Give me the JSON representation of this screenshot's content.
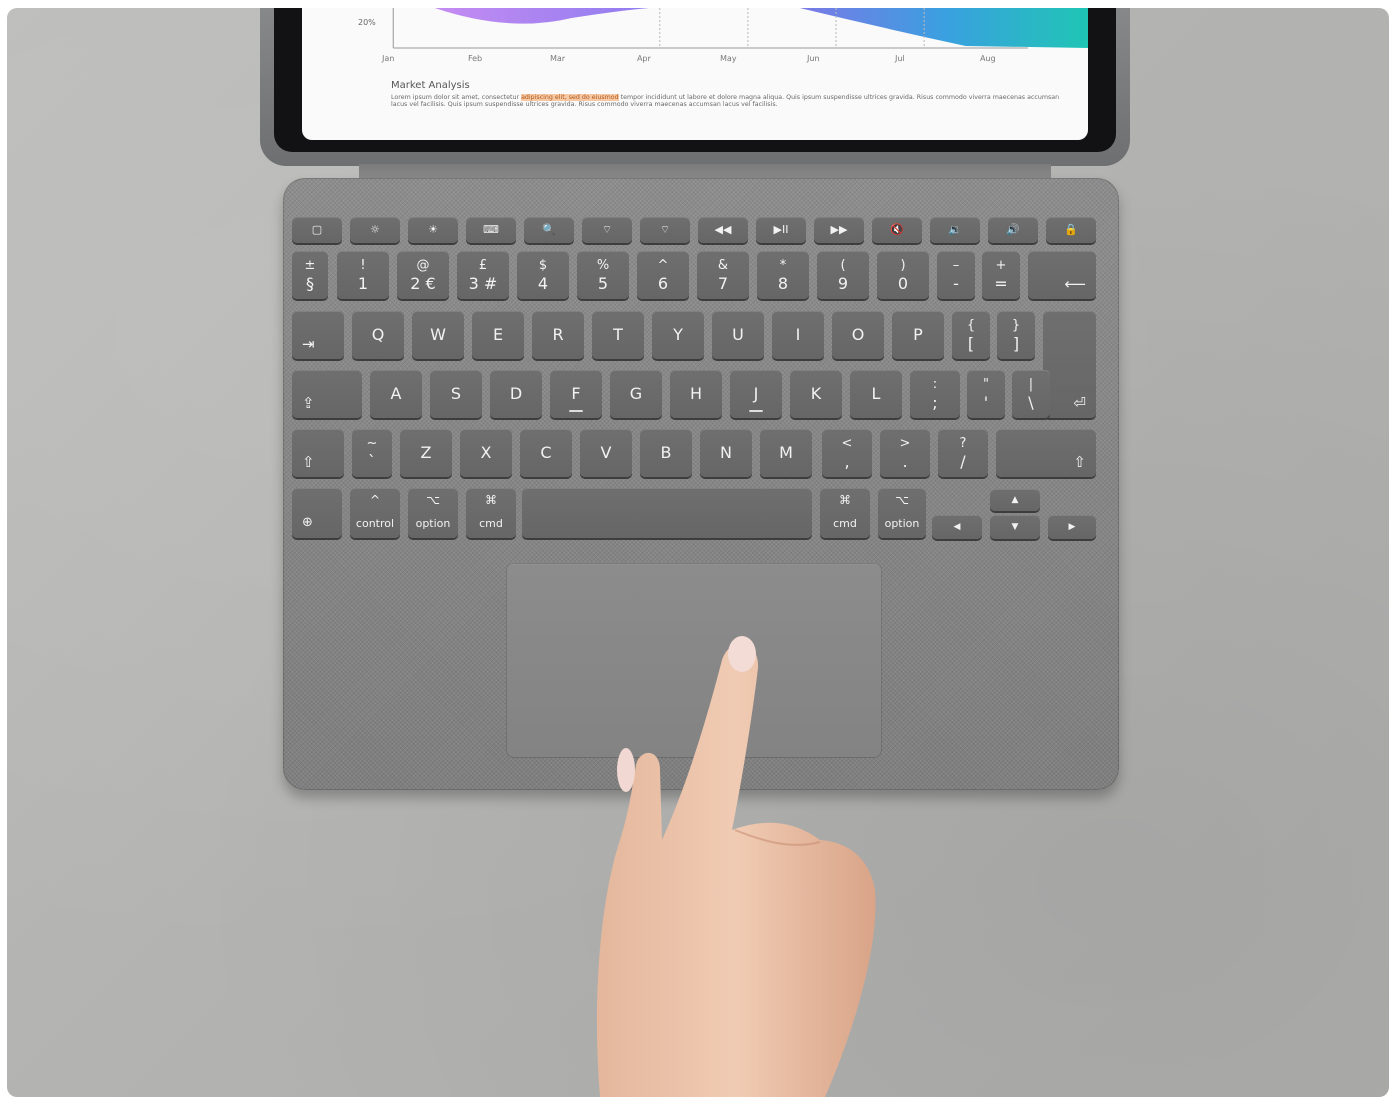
{
  "chart": {
    "percent_label": "20%",
    "months": [
      "Jan",
      "Feb",
      "Mar",
      "Apr",
      "May",
      "Jun",
      "Jul",
      "Aug"
    ]
  },
  "document": {
    "title": "Market Analysis",
    "body_before": "Lorem ipsum dolor sit amet, consectetur ",
    "body_highlight": "adipiscing elit, sed do eiusmod",
    "body_after": " tempor incididunt ut labore et dolore magna aliqua. Quis ipsum suspendisse ultrices gravida. Risus commodo viverra maecenas accumsan lacus vel facilisis. Quis ipsum suspendisse ultrices gravida. Risus commodo viverra maecenas accumsan lacus vel facilisis."
  },
  "keyboard": {
    "function_row": [
      "▢",
      "☼",
      "☀",
      "⌨",
      "🔍",
      "⌔",
      "⌔",
      "◀◀",
      "▶II",
      "▶▶",
      "🔇",
      "🔉",
      "🔊",
      "🔒"
    ],
    "number_row": [
      {
        "top": "±",
        "bot": "§"
      },
      {
        "top": "!",
        "bot": "1"
      },
      {
        "top": "@",
        "bot": "2 €"
      },
      {
        "top": "£",
        "bot": "3 #"
      },
      {
        "top": "$",
        "bot": "4"
      },
      {
        "top": "%",
        "bot": "5"
      },
      {
        "top": "^",
        "bot": "6"
      },
      {
        "top": "&",
        "bot": "7"
      },
      {
        "top": "*",
        "bot": "8"
      },
      {
        "top": "(",
        "bot": "9"
      },
      {
        "top": ")",
        "bot": "0"
      },
      {
        "top": "–",
        "bot": "-"
      },
      {
        "top": "+",
        "bot": "="
      }
    ],
    "backspace": "⟵",
    "tab": "⇥",
    "qwerty_row": [
      "Q",
      "W",
      "E",
      "R",
      "T",
      "Y",
      "U",
      "I",
      "O",
      "P"
    ],
    "brackets": [
      {
        "top": "{",
        "bot": "["
      },
      {
        "top": "}",
        "bot": "]"
      }
    ],
    "return": "⏎",
    "caps": "⇪",
    "home_row": [
      "A",
      "S",
      "D",
      "F",
      "G",
      "H",
      "J",
      "K",
      "L"
    ],
    "home_punct": [
      {
        "top": ":",
        "bot": ";"
      },
      {
        "top": "\"",
        "bot": "'"
      },
      {
        "top": "|",
        "bot": "\\"
      }
    ],
    "shift": "⇧",
    "tilde": {
      "top": "~",
      "bot": "`"
    },
    "bottom_letters": [
      "Z",
      "X",
      "C",
      "V",
      "B",
      "N",
      "M"
    ],
    "bottom_punct": [
      {
        "top": "<",
        "bot": ","
      },
      {
        "top": ">",
        "bot": "."
      },
      {
        "top": "?",
        "bot": "/"
      }
    ],
    "globe": "⊕",
    "control": {
      "glyph": "^",
      "label": "control"
    },
    "option_left": {
      "glyph": "⌥",
      "label": "option"
    },
    "cmd_left": {
      "glyph": "⌘",
      "label": "cmd"
    },
    "cmd_right": {
      "glyph": "⌘",
      "label": "cmd"
    },
    "option_right": {
      "glyph": "⌥",
      "label": "option"
    },
    "arrows": {
      "up": "▲",
      "left": "◀",
      "down": "▼",
      "right": "▶"
    }
  }
}
